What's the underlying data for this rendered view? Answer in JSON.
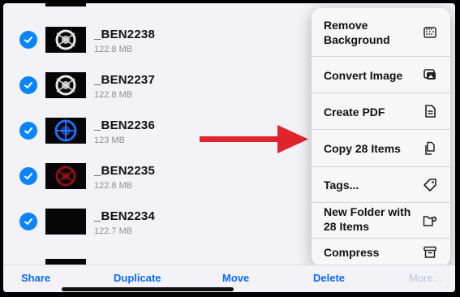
{
  "files": [
    {
      "name": "_BEN2238",
      "size": "122.8 MB",
      "thumb": "white"
    },
    {
      "name": "_BEN2237",
      "size": "122.8 MB",
      "thumb": "white"
    },
    {
      "name": "_BEN2236",
      "size": "123 MB",
      "thumb": "blue"
    },
    {
      "name": "_BEN2235",
      "size": "122.8 MB",
      "thumb": "red"
    },
    {
      "name": "_BEN2234",
      "size": "122.7 MB",
      "thumb": "dark"
    }
  ],
  "menu": [
    {
      "label": "Remove Background",
      "icon": "remove-background-icon"
    },
    {
      "label": "Convert Image",
      "icon": "convert-image-icon"
    },
    {
      "label": "Create PDF",
      "icon": "pdf-document-icon"
    },
    {
      "label": "Copy 28 Items",
      "icon": "copy-icon"
    },
    {
      "label": "Tags...",
      "icon": "tag-icon"
    },
    {
      "label": "New Folder with 28 Items",
      "icon": "new-folder-icon"
    },
    {
      "label": "Compress",
      "icon": "archive-box-icon"
    }
  ],
  "toolbar": {
    "share": "Share",
    "duplicate": "Duplicate",
    "move": "Move",
    "delete": "Delete",
    "more": "More..."
  },
  "colors": {
    "accent": "#0a84ff",
    "arrow": "#e0242c",
    "background": "#f2f2f7"
  }
}
